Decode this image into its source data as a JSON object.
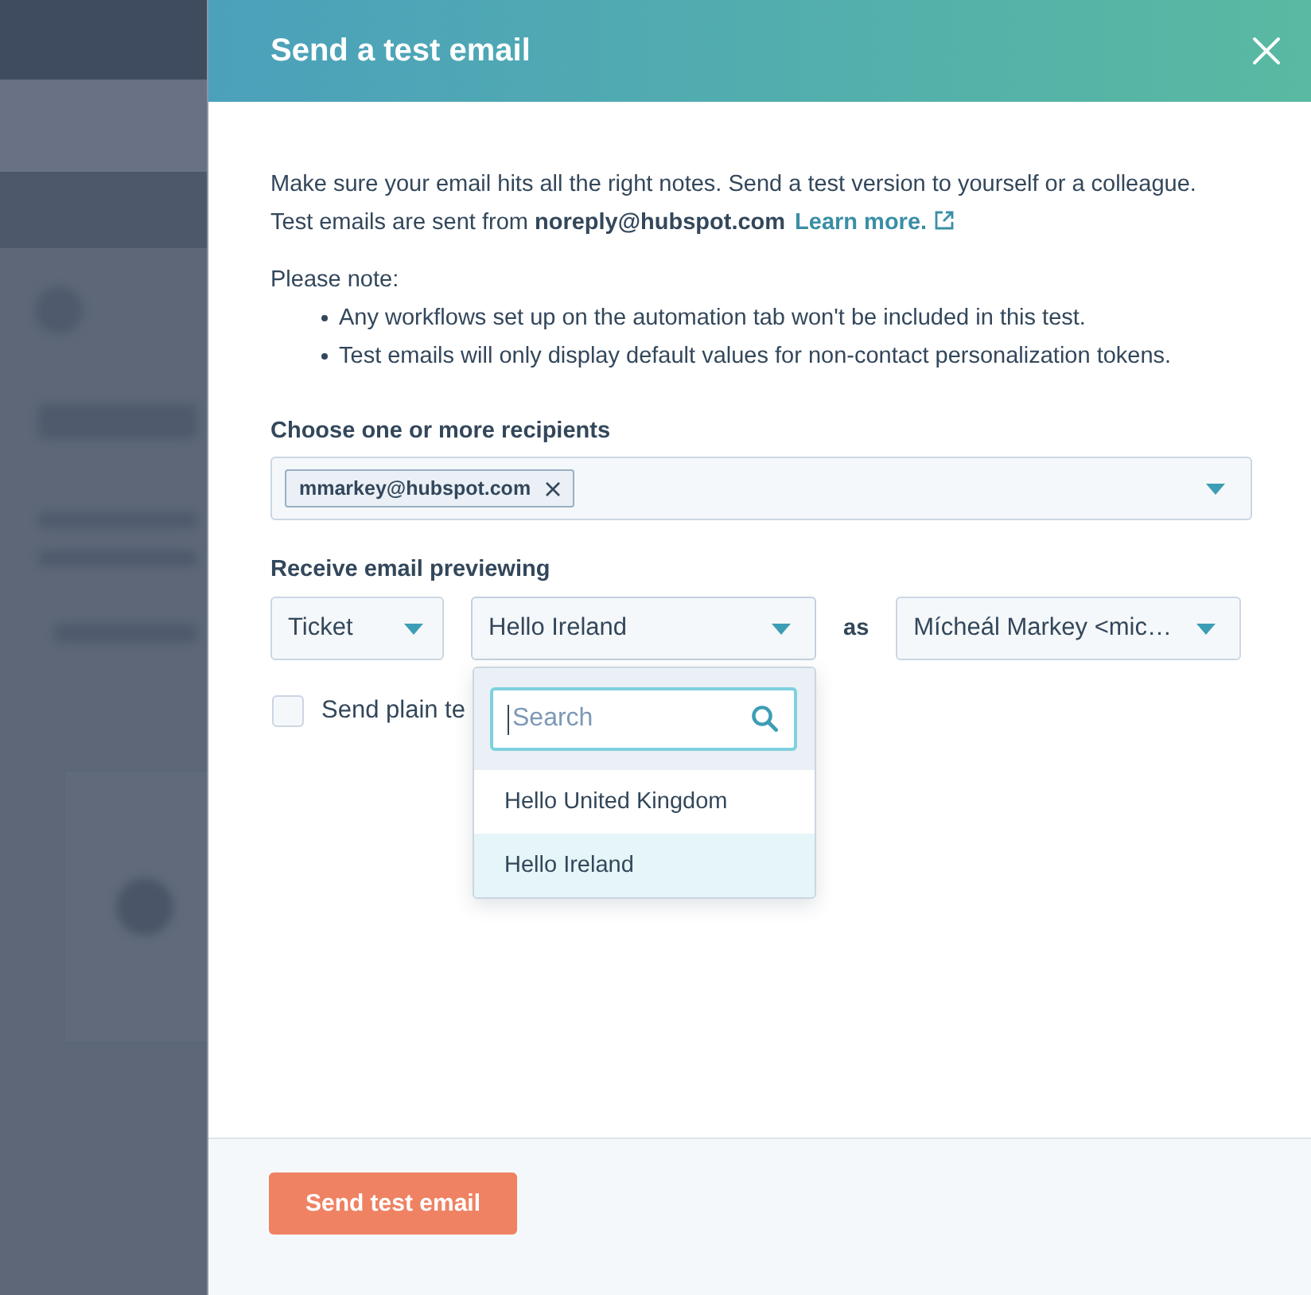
{
  "dialog": {
    "title": "Send a test email"
  },
  "intro": {
    "text": "Make sure your email hits all the right notes. Send a test version to yourself or a colleague. Test emails are sent from **noreply@hubspot.com**",
    "link": "Learn more."
  },
  "note": {
    "label": "Please note:",
    "bullets": [
      "Any workflows set up on the automation tab won't be included in this test.",
      "Test emails will only display default values for non-contact personalization tokens."
    ]
  },
  "recipients": {
    "label": "Choose one or more recipients",
    "chips": [
      "mmarkey@hubspot.com"
    ]
  },
  "preview": {
    "label": "Receive email previewing",
    "object_type": "Ticket",
    "record": {
      "value": "Hello Ireland",
      "open": true,
      "search": {
        "placeholder": "Search",
        "focused": true
      },
      "options": [
        {
          "label": "Hello United Kingdom",
          "selected": false
        },
        {
          "label": "Hello Ireland",
          "selected": true
        }
      ]
    },
    "as_label": "as",
    "contact": "Mícheál Markey <mic…"
  },
  "plain_text": {
    "label": "Send plain te",
    "checked": false
  },
  "footer": {
    "button": "Send test email"
  }
}
